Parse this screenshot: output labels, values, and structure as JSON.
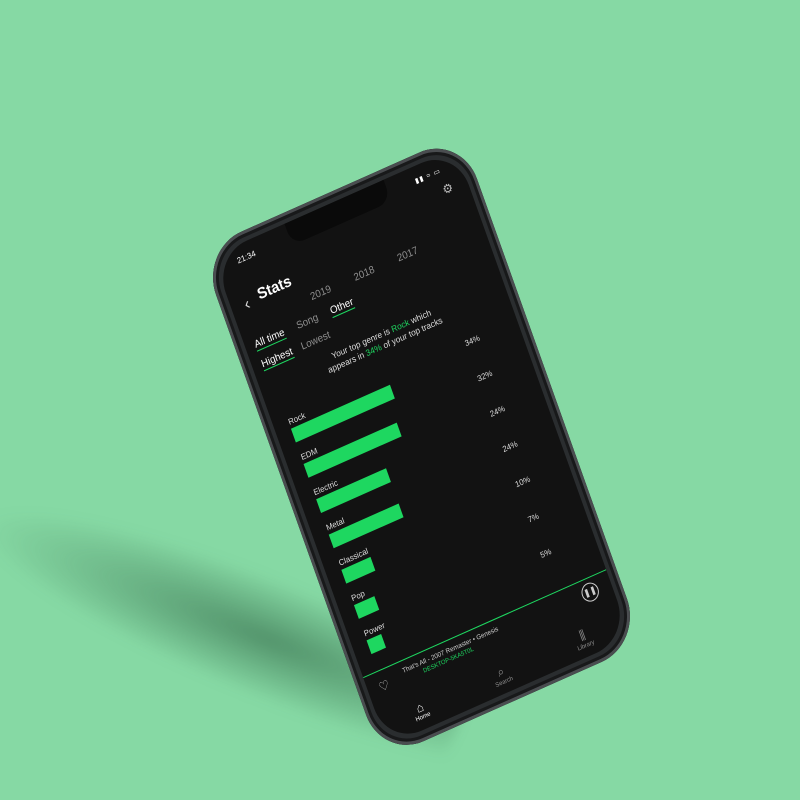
{
  "status": {
    "time": "21:34",
    "icons": "▮▮ ≈ ▭"
  },
  "header": {
    "title": "Stats"
  },
  "tabs_years": [
    "2019",
    "2018",
    "2017"
  ],
  "tabs_scope": [
    "All time",
    "Song",
    "Other"
  ],
  "tabs_sort": [
    "Highest",
    "Lowest"
  ],
  "caption": {
    "pre": "Your top genre is ",
    "genre": "Rock",
    "mid": " which appears in ",
    "pct": "34%",
    "post": " of your top tracks"
  },
  "chart_data": {
    "type": "bar",
    "categories": [
      "Rock",
      "EDM",
      "Electric",
      "Metal",
      "Classical",
      "Pop",
      "Power"
    ],
    "values": [
      34,
      32,
      24,
      24,
      10,
      7,
      5
    ],
    "value_labels": [
      "34%",
      "32%",
      "24%",
      "24%",
      "10%",
      "7%",
      "5%"
    ],
    "bar_color": "#1ed760"
  },
  "now_playing": {
    "title": "That's All - 2007 Remaster • Genesis",
    "device": "DESKTOP-5KA5T0L"
  },
  "nav": [
    {
      "label": "Home",
      "icon": "home-icon"
    },
    {
      "label": "Search",
      "icon": "search-icon"
    },
    {
      "label": "Library",
      "icon": "library-icon"
    }
  ],
  "colors": {
    "accent": "#1ed760",
    "background": "#121212",
    "page": "#86d9a4"
  }
}
